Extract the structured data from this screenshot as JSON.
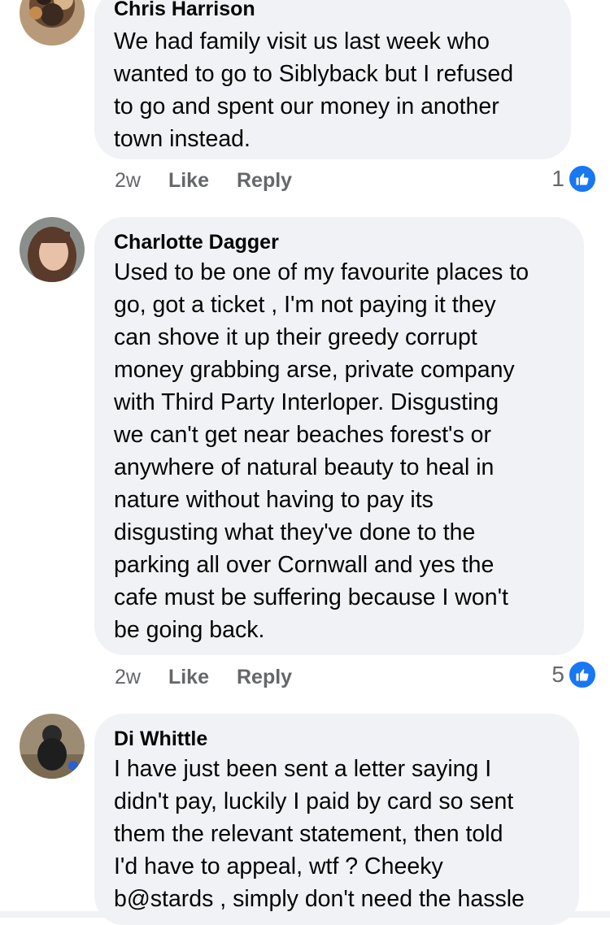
{
  "colors": {
    "bubble": "#f0f2f5",
    "meta_text": "#65676b",
    "like_blue": "#1877f2"
  },
  "comments": [
    {
      "author": "Chris Harrison",
      "text": "We had family visit us last week who\nwanted to go to Siblyback but I refused\nto go and spent our money in another\ntown instead.",
      "time": "2w",
      "like_label": "Like",
      "reply_label": "Reply",
      "reaction_count": "1",
      "reaction_icon": "thumbs-up-icon"
    },
    {
      "author": "Charlotte Dagger",
      "text": "Used to be one of my favourite places to\ngo,  got a ticket , I'm not paying it they\ncan shove it up their greedy corrupt\nmoney grabbing arse, private company\nwith Third Party Interloper. Disgusting\nwe can't get near beaches forest's or\nanywhere of natural beauty to heal in\nnature without having to pay its\ndisgusting what they've done to the\nparking all over Cornwall and yes the\ncafe must be suffering because I won't\nbe going back.",
      "time": "2w",
      "like_label": "Like",
      "reply_label": "Reply",
      "reaction_count": "5",
      "reaction_icon": "thumbs-up-icon"
    },
    {
      "author": "Di Whittle",
      "text": "I have just been sent a letter saying I\ndidn't pay, luckily I paid by card so sent\nthem the relevant statement, then told\nI'd have to appeal, wtf ? Cheeky\nb@stards , simply don't need the hassle"
    }
  ]
}
